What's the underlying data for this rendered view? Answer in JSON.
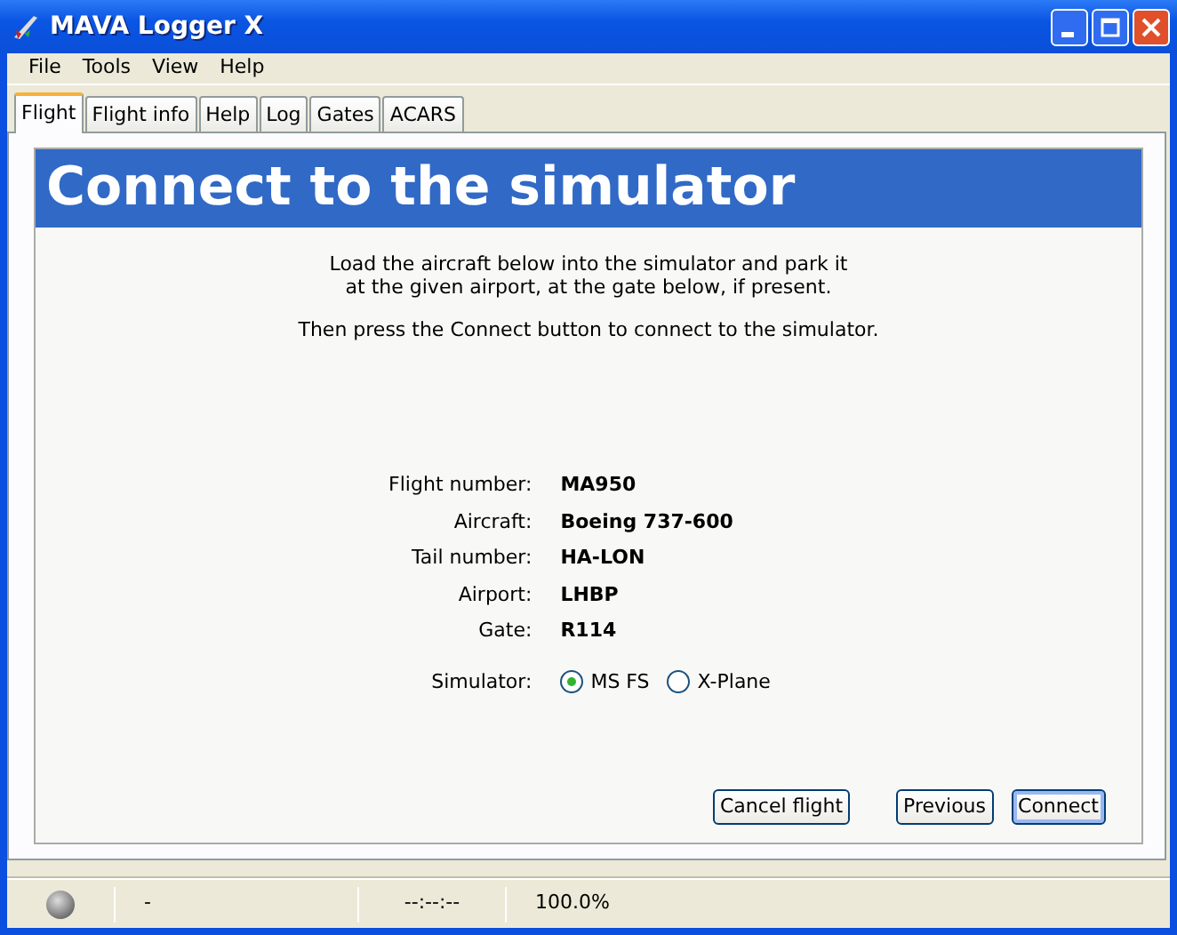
{
  "window": {
    "title": "MAVA Logger X"
  },
  "menu": [
    "File",
    "Tools",
    "View",
    "Help"
  ],
  "tabs": [
    {
      "label": "Flight",
      "selected": true
    },
    {
      "label": "Flight info",
      "selected": false
    },
    {
      "label": "Help",
      "selected": false
    },
    {
      "label": "Log",
      "selected": false
    },
    {
      "label": "Gates",
      "selected": false
    },
    {
      "label": "ACARS",
      "selected": false
    }
  ],
  "page": {
    "heading": "Connect to the simulator",
    "instructions": [
      [
        "Load the aircraft below into the simulator and park it",
        "at the given airport, at the gate below, if present."
      ],
      [
        "Then press the Connect button to connect to the simulator."
      ]
    ],
    "fields": [
      {
        "label": "Flight number:",
        "value": "MA950"
      },
      {
        "label": "Aircraft:",
        "value": "Boeing 737-600"
      },
      {
        "label": "Tail number:",
        "value": "HA-LON"
      },
      {
        "label": "Airport:",
        "value": "LHBP"
      },
      {
        "label": "Gate:",
        "value": "R114"
      }
    ],
    "simulator": {
      "label": "Simulator:",
      "options": [
        {
          "label": "MS FS",
          "selected": true
        },
        {
          "label": "X-Plane",
          "selected": false
        }
      ]
    },
    "buttons": [
      {
        "label": "Cancel flight",
        "default": false
      },
      {
        "label": "Previous",
        "default": false
      },
      {
        "label": "Connect",
        "default": true
      }
    ]
  },
  "status_bar": {
    "connected": false,
    "message": "-",
    "time": "--:--:--",
    "rate": "100.0%"
  }
}
